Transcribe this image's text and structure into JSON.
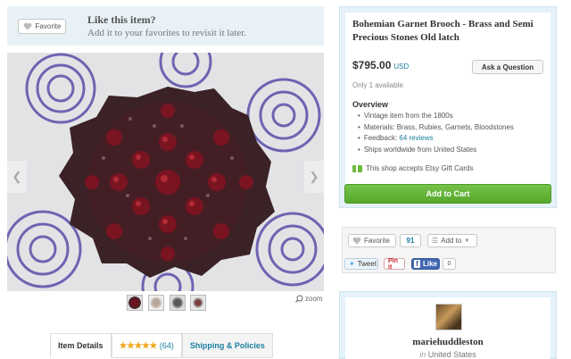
{
  "favorite_banner": {
    "button_label": "Favorite",
    "title": "Like this item?",
    "subtitle": "Add it to your favorites to revisit it later."
  },
  "gallery": {
    "main_image_icon": "garnet-brooch-image",
    "zoom_label": "zoom",
    "thumbnail_count": 4
  },
  "tabs": {
    "item_details": "Item Details",
    "stars": "★★★★★",
    "review_count": "(64)",
    "shipping": "Shipping & Policies"
  },
  "item": {
    "title": "Bohemian Garnet Brooch - Brass and Semi Precious Stones Old latch",
    "price": "$795.00",
    "currency": "USD",
    "ask_button": "Ask a Question",
    "availability": "Only 1 available",
    "overview_title": "Overview",
    "overview": {
      "vintage": "Vintage item from the 1800s",
      "materials": "Materials: Brass, Rubies, Garnets, Bloodstones",
      "feedback_prefix": "Feedback: ",
      "feedback_link": "64 reviews",
      "ships": "Ships worldwide from United States"
    },
    "gift_cards": "This shop accepts Etsy Gift Cards",
    "add_to_cart": "Add to Cart"
  },
  "social": {
    "favorite_label": "Favorite",
    "favorite_count": "91",
    "add_to_label": "Add to",
    "tweet_label": "Tweet",
    "pin_label": "Pin it",
    "like_label": "Like",
    "like_count": "0"
  },
  "shop": {
    "name": "mariehuddleston",
    "location_prefix": "in",
    "location": "United States"
  },
  "colors": {
    "accent_blue": "#1a7fa0",
    "cart_green": "#5cb335",
    "panel_blue": "#e4f2f9",
    "garnet_red": "#8a0f18"
  }
}
